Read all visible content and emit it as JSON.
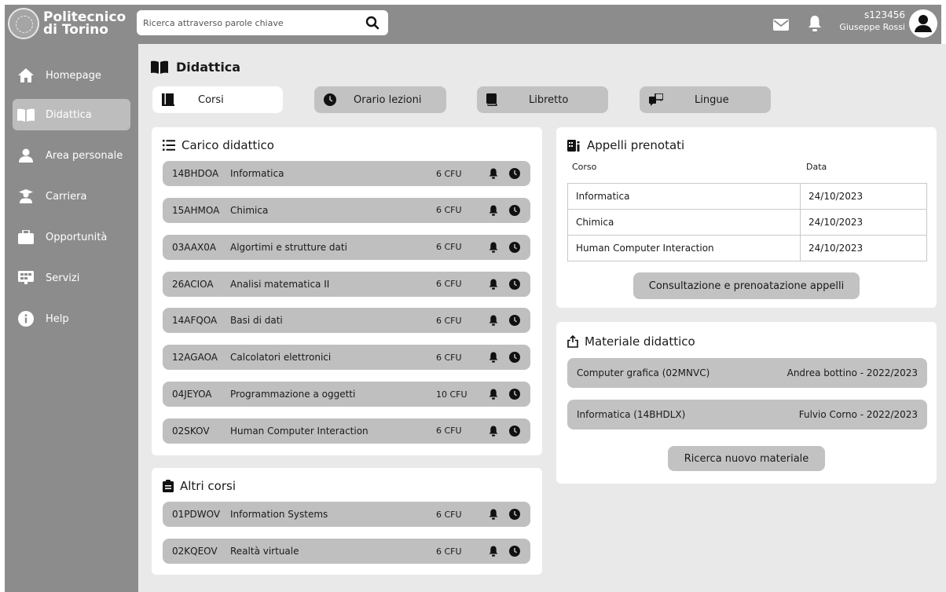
{
  "brand": {
    "name_line1": "Politecnico",
    "name_line2": "di Torino"
  },
  "search": {
    "placeholder": "Ricerca attraverso parole chiave"
  },
  "user": {
    "id": "s123456",
    "name": "Giuseppe Rossi"
  },
  "sidebar": {
    "items": [
      {
        "label": "Homepage",
        "icon": "home-icon"
      },
      {
        "label": "Didattica",
        "icon": "book-icon",
        "active": true
      },
      {
        "label": "Area personale",
        "icon": "person-icon"
      },
      {
        "label": "Carriera",
        "icon": "graduate-icon"
      },
      {
        "label": "Opportunità",
        "icon": "briefcase-icon"
      },
      {
        "label": "Servizi",
        "icon": "services-icon"
      },
      {
        "label": "Help",
        "icon": "info-icon"
      }
    ]
  },
  "page": {
    "title": "Didattica"
  },
  "tabs": [
    {
      "label": "Corsi",
      "icon": "books-icon",
      "active": true
    },
    {
      "label": "Orario lezioni",
      "icon": "clock-icon"
    },
    {
      "label": "Libretto",
      "icon": "booklet-icon"
    },
    {
      "label": "Lingue",
      "icon": "translate-icon"
    }
  ],
  "carico": {
    "title": "Carico didattico",
    "courses": [
      {
        "code": "14BHDOA",
        "name": "Informatica",
        "cfu": "6 CFU"
      },
      {
        "code": "15AHMOA",
        "name": "Chimica",
        "cfu": "6 CFU"
      },
      {
        "code": "03AAX0A",
        "name": "Algortimi e strutture dati",
        "cfu": "6 CFU"
      },
      {
        "code": "26ACIOA",
        "name": "Analisi matematica II",
        "cfu": "6 CFU"
      },
      {
        "code": "14AFQOA",
        "name": "Basi di dati",
        "cfu": "6 CFU"
      },
      {
        "code": "12AGAOA",
        "name": "Calcolatori elettronici",
        "cfu": "6 CFU"
      },
      {
        "code": "04JEYOA",
        "name": "Programmazione a oggetti",
        "cfu": "10 CFU"
      },
      {
        "code": "02SKOV",
        "name": "Human Computer Interaction",
        "cfu": "6 CFU"
      }
    ]
  },
  "altri": {
    "title": "Altri corsi",
    "courses": [
      {
        "code": "01PDWOV",
        "name": "Information Systems",
        "cfu": "6 CFU"
      },
      {
        "code": "02KQEOV",
        "name": "Realtà virtuale",
        "cfu": "6 CFU"
      }
    ]
  },
  "appelli": {
    "title": "Appelli prenotati",
    "col_course": "Corso",
    "col_date": "Data",
    "rows": [
      {
        "course": "Informatica",
        "date": "24/10/2023"
      },
      {
        "course": "Chimica",
        "date": "24/10/2023"
      },
      {
        "course": "Human Computer Interaction",
        "date": "24/10/2023"
      }
    ],
    "button": "Consultazione e prenoatazione appelli"
  },
  "materiale": {
    "title": "Materiale didattico",
    "items": [
      {
        "course": "Computer grafica (02MNVC)",
        "info": "Andrea bottino - 2022/2023"
      },
      {
        "course": "Informatica (14BHDLX)",
        "info": "Fulvio Corno - 2022/2023"
      }
    ],
    "button": "Ricerca nuovo materiale"
  },
  "colors": {
    "sidebar": "#8c8c8c",
    "main_bg": "#e9e9e9",
    "row_bg": "#bfbfbf",
    "active_item": "#bdbdbd"
  }
}
